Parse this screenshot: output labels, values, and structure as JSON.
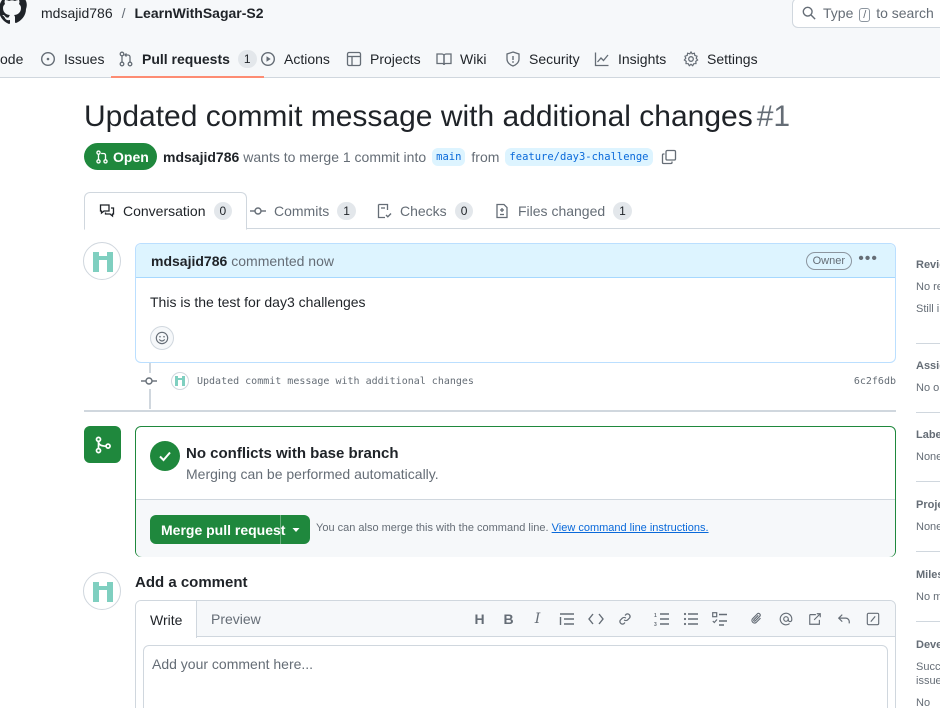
{
  "header": {
    "owner": "mdsajid786",
    "separator": "/",
    "repo": "LearnWithSagar-S2",
    "search_placeholder_pre": "Type",
    "search_key": "/",
    "search_placeholder_post": "to search"
  },
  "repo_tabs": [
    {
      "label": "ode"
    },
    {
      "label": "Issues"
    },
    {
      "label": "Pull requests",
      "count": "1"
    },
    {
      "label": "Actions"
    },
    {
      "label": "Projects"
    },
    {
      "label": "Wiki"
    },
    {
      "label": "Security"
    },
    {
      "label": "Insights"
    },
    {
      "label": "Settings"
    }
  ],
  "pr": {
    "title": "Updated commit message with additional changes",
    "number": "#1",
    "status": "Open",
    "author": "mdsajid786",
    "merge_text": "wants to merge 1 commit into",
    "base_branch": "main",
    "from_text": "from",
    "head_branch": "feature/day3-challenge"
  },
  "pr_tabs": [
    {
      "label": "Conversation",
      "count": "0"
    },
    {
      "label": "Commits",
      "count": "1"
    },
    {
      "label": "Checks",
      "count": "0"
    },
    {
      "label": "Files changed",
      "count": "1"
    }
  ],
  "comment": {
    "author": "mdsajid786",
    "time": "commented now",
    "role": "Owner",
    "body": "This is the test for day3 challenges"
  },
  "commit": {
    "message": "Updated commit message with additional changes",
    "sha": "6c2f6db"
  },
  "merge": {
    "title": "No conflicts with base branch",
    "subtitle": "Merging can be performed automatically.",
    "button": "Merge pull request",
    "note": "You can also merge this with the command line.",
    "link": "View command line instructions."
  },
  "add_comment": {
    "title": "Add a comment",
    "tab_write": "Write",
    "tab_preview": "Preview",
    "placeholder": "Add your comment here..."
  },
  "sidebar": {
    "reviewers_h": "Revie",
    "reviewers_t1": "No re",
    "reviewers_t2": "Still i",
    "assignees_h": "Assig",
    "assignees_t": "No o",
    "labels_h": "Labe",
    "labels_t": "None",
    "projects_h": "Proje",
    "projects_t": "None",
    "milestone_h": "Miles",
    "milestone_t": "No m",
    "dev_h": "Deve",
    "dev_t1": "Succe",
    "dev_t2": "issue",
    "dev_t3": "No"
  },
  "colors": {
    "green": "#1f883d",
    "accent_blue": "#0969da",
    "tab_underline": "#fd8c73"
  }
}
